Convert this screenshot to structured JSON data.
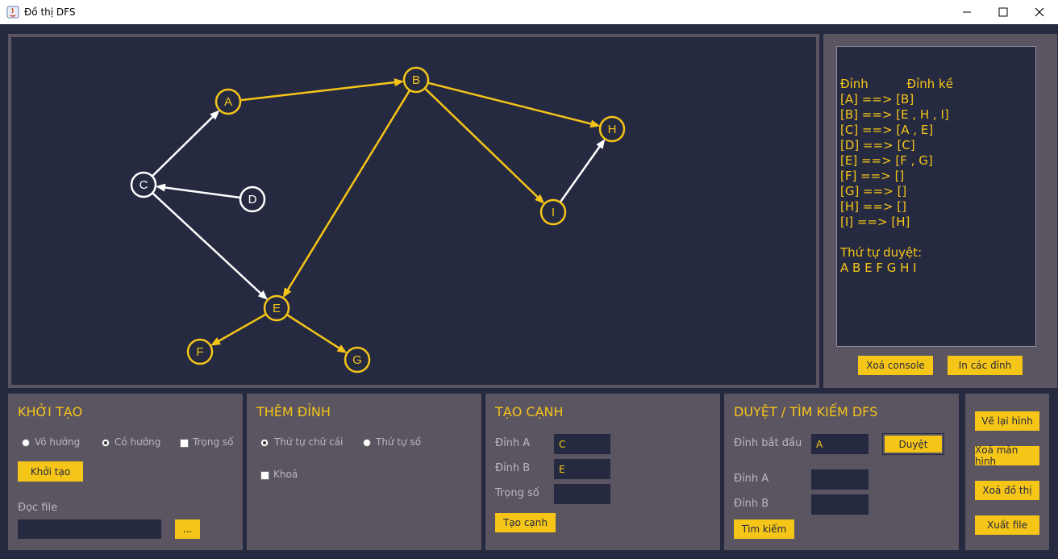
{
  "window": {
    "title": "Đồ thị DFS",
    "min": "—",
    "max": "☐",
    "close": "✕"
  },
  "graph": {
    "nodes": [
      {
        "id": "A",
        "color": "#f5c518"
      },
      {
        "id": "B",
        "color": "#f5c518"
      },
      {
        "id": "C",
        "color": "#ffffff"
      },
      {
        "id": "D",
        "color": "#ffffff"
      },
      {
        "id": "E",
        "color": "#f5c518"
      },
      {
        "id": "F",
        "color": "#f5c518"
      },
      {
        "id": "G",
        "color": "#f5c518"
      },
      {
        "id": "H",
        "color": "#f5c518"
      },
      {
        "id": "I",
        "color": "#f5c518"
      }
    ],
    "edges": [
      {
        "from": "A",
        "to": "B",
        "color": "#f5c518"
      },
      {
        "from": "B",
        "to": "E",
        "color": "#f5c518"
      },
      {
        "from": "B",
        "to": "H",
        "color": "#f5c518"
      },
      {
        "from": "B",
        "to": "I",
        "color": "#f5c518"
      },
      {
        "from": "C",
        "to": "A",
        "color": "#ffffff"
      },
      {
        "from": "C",
        "to": "E",
        "color": "#ffffff"
      },
      {
        "from": "D",
        "to": "C",
        "color": "#ffffff"
      },
      {
        "from": "E",
        "to": "F",
        "color": "#f5c518"
      },
      {
        "from": "E",
        "to": "G",
        "color": "#f5c518"
      },
      {
        "from": "I",
        "to": "H",
        "color": "#ffffff"
      }
    ]
  },
  "console": {
    "lines": [
      "Đỉnh          Đỉnh kề",
      "[A] ==> [B]",
      "[B] ==> [E , H , I]",
      "[C] ==> [A , E]",
      "[D] ==> [C]",
      "[E] ==> [F , G]",
      "[F] ==> []",
      "[G] ==> []",
      "[H] ==> []",
      "[I] ==> [H]",
      "",
      "Thứ tự duyệt:",
      "A B E F G H I"
    ],
    "clear_label": "Xoá console",
    "print_label": "In các đỉnh"
  },
  "init": {
    "title": "KHỞI TẠO",
    "undirected": "Vô hướng",
    "directed": "Có hướng",
    "weighted": "Trọng số",
    "init_button": "Khởi tạo",
    "read_file": "Đọc file",
    "browse": "..."
  },
  "add_vertex": {
    "title": "THÊM ĐỈNH",
    "alpha": "Thứ tự chữ cái",
    "numeric": "Thứ tự số",
    "lock": "Khoá"
  },
  "create_edge": {
    "title": "TẠO CẠNH",
    "vertex_a": "Đỉnh A",
    "vertex_b": "Đỉnh B",
    "weight": "Trọng số",
    "a_value": "C",
    "b_value": "E",
    "weight_value": "",
    "create_button": "Tạo cạnh"
  },
  "dfs": {
    "title": "DUYỆT / TÌM KIẾM DFS",
    "start_label": "Đỉnh bắt đầu",
    "start_value": "A",
    "traverse_button": "Duyệt",
    "vertex_a": "Đỉnh A",
    "vertex_b": "Đỉnh B",
    "a_value": "",
    "b_value": "",
    "search_button": "Tìm kiếm"
  },
  "actions": {
    "redraw": "Vẽ lại hình",
    "clear_screen": "Xoá màn hình",
    "clear_graph": "Xoá đồ thị",
    "export": "Xuất file"
  }
}
